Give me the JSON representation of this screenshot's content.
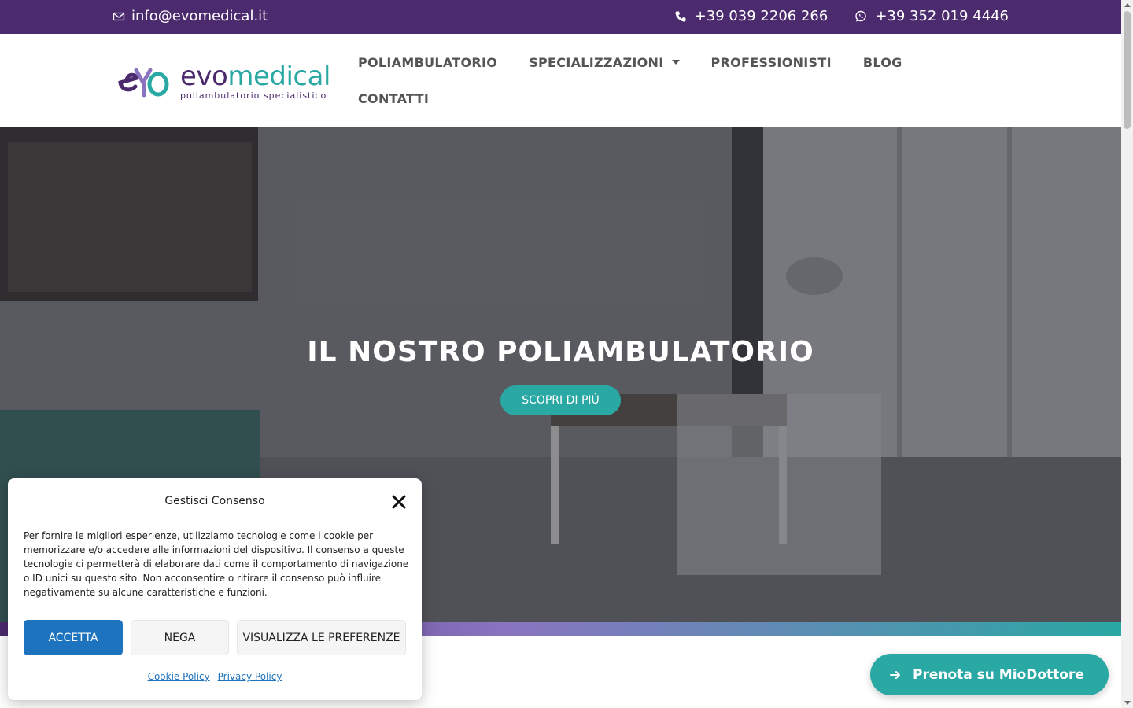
{
  "topbar": {
    "email": "info@evomedical.it",
    "phone": "+39 039 2206 266",
    "whatsapp": "+39 352 019 4446",
    "background": "#4b2a6e"
  },
  "logo": {
    "word_evo": "evo",
    "word_medical": "medical",
    "tagline": "poliambulatorio specialistico"
  },
  "nav": {
    "items": [
      {
        "label": "POLIAMBULATORIO"
      },
      {
        "label": "SPECIALIZZAZIONI",
        "has_dropdown": true
      },
      {
        "label": "PROFESSIONISTI"
      },
      {
        "label": "BLOG"
      },
      {
        "label": "CONTATTI"
      }
    ]
  },
  "hero": {
    "title": "IL NOSTRO POLIAMBULATORIO",
    "button": "SCOPRI DI PIÙ",
    "accent": "#2aa8a4"
  },
  "consent": {
    "title": "Gestisci Consenso",
    "text": "Per fornire le migliori esperienze, utilizziamo tecnologie come i cookie per memorizzare e/o accedere alle informazioni del dispositivo. Il consenso a queste tecnologie ci permetterà di elaborare dati come il comportamento di navigazione o ID unici su questo sito. Non acconsentire o ritirare il consenso può influire negativamente su alcune caratteristiche e funzioni.",
    "accept": "ACCETTA",
    "deny": "NEGA",
    "preferences": "VISUALIZZA LE PREFERENZE",
    "cookie_policy": "Cookie Policy",
    "privacy_policy": "Privacy Policy",
    "accept_color": "#1e73be"
  },
  "cta": {
    "label": "Prenota su MioDottore"
  }
}
